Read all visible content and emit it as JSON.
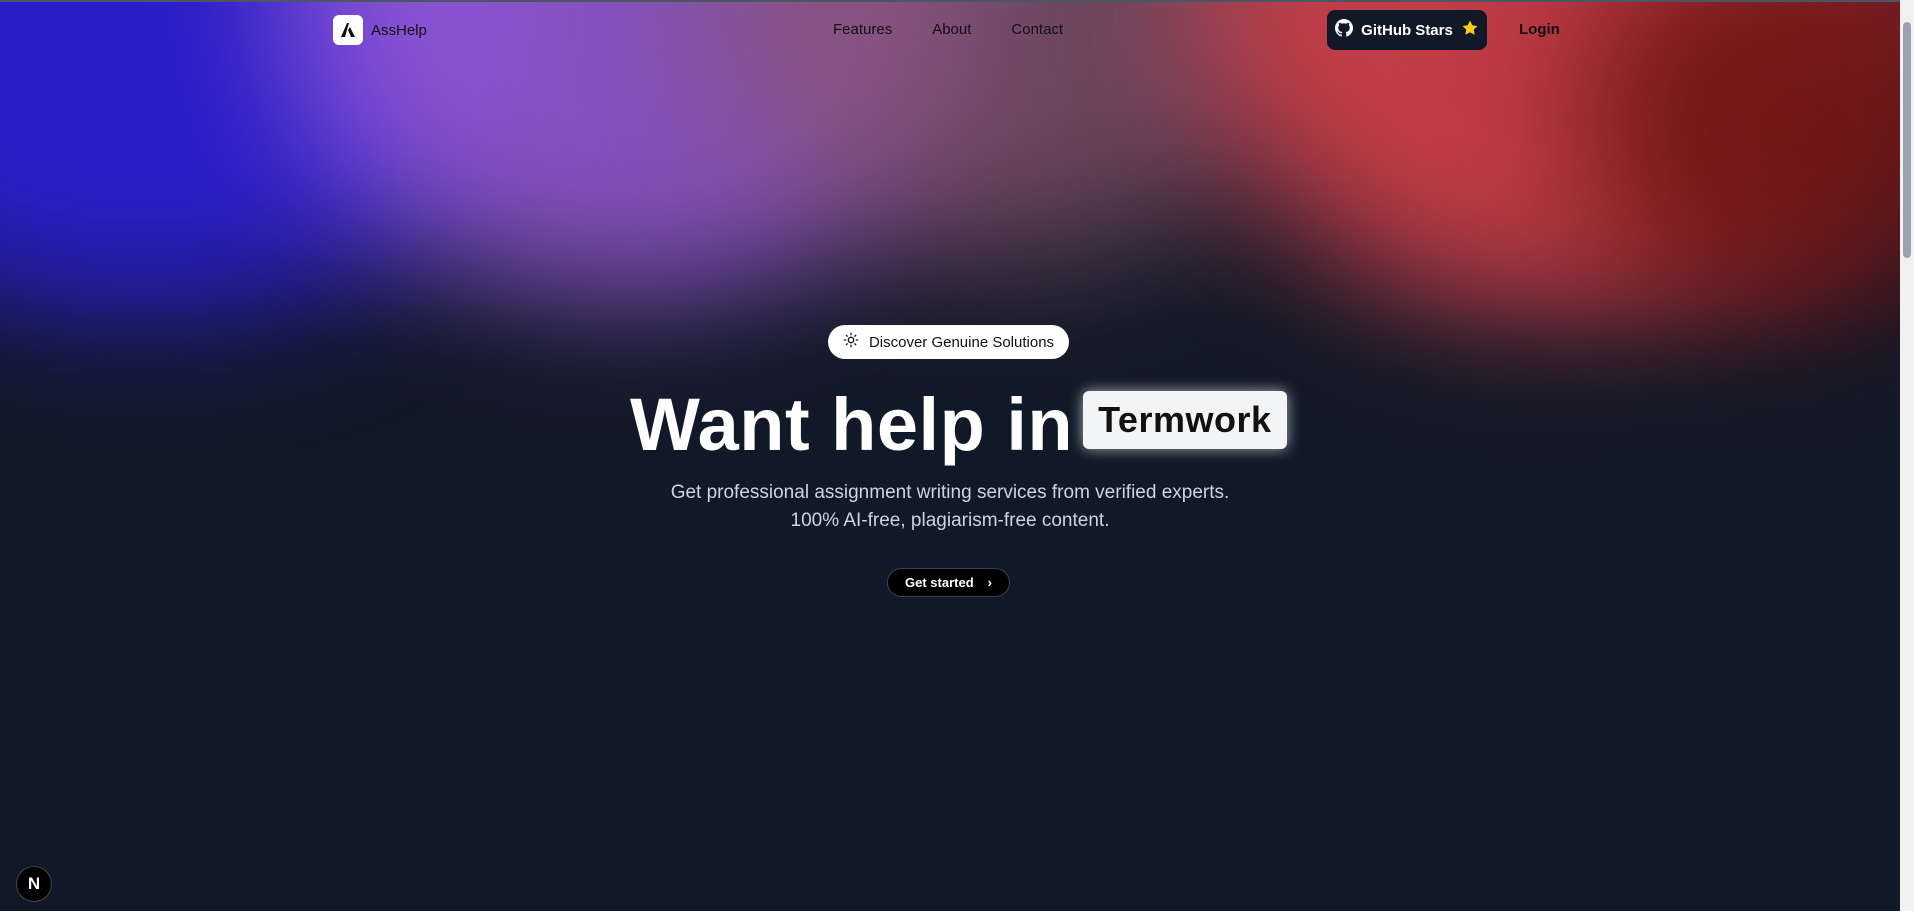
{
  "brand": {
    "name": "AssHelp",
    "logo_icon": "logo-a-icon"
  },
  "nav": {
    "links": [
      {
        "label": "Features"
      },
      {
        "label": "About"
      },
      {
        "label": "Contact"
      }
    ],
    "github_label": "GitHub Stars",
    "login_label": "Login"
  },
  "hero": {
    "badge": "Discover Genuine Solutions",
    "headline": "Want help in",
    "rotating_word": "Termwork",
    "subtitle_line1": "Get professional assignment writing services from verified experts.",
    "subtitle_line2": "100% AI-free, plagiarism-free content.",
    "cta_label": "Get started",
    "cta_arrow": "›"
  },
  "dev_badge": {
    "label": "N"
  },
  "colors": {
    "background": "#111827",
    "blue": "#2a1fd0",
    "purple": "#9a5bd6",
    "red": "#d4414a",
    "star": "#facc15"
  }
}
